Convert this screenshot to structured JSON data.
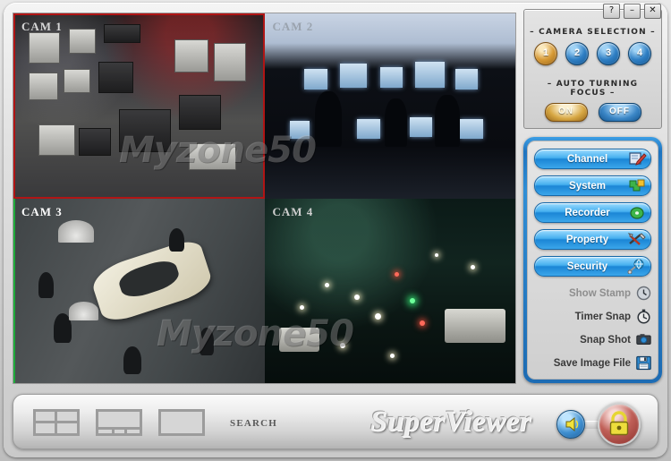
{
  "window": {
    "titlebar_buttons": [
      {
        "name": "help-button",
        "glyph": "?"
      },
      {
        "name": "minimize-button",
        "glyph": "–"
      },
      {
        "name": "close-button",
        "glyph": "✕"
      }
    ]
  },
  "video": {
    "cells": [
      {
        "label": "CAM 1",
        "scene": "security-equipment-shop",
        "active": true
      },
      {
        "label": "CAM 2",
        "scene": "control-room",
        "active": false
      },
      {
        "label": "CAM 3",
        "scene": "aerial-street-car",
        "active": false
      },
      {
        "label": "CAM 4",
        "scene": "night-traffic",
        "active": false
      }
    ],
    "watermark": "Myzone50"
  },
  "camera_selection": {
    "title": "–  CAMERA  SELECTION  –",
    "buttons": [
      {
        "label": "1",
        "selected": true
      },
      {
        "label": "2",
        "selected": false
      },
      {
        "label": "3",
        "selected": false
      },
      {
        "label": "4",
        "selected": false
      }
    ]
  },
  "auto_turning_focus": {
    "title": "–  AUTO  TURNING  FOCUS  –",
    "on_label": "ON",
    "off_label": "OFF",
    "selected": "ON"
  },
  "menu": {
    "items": [
      {
        "label": "Channel",
        "icon": "note-pencil-icon"
      },
      {
        "label": "System",
        "icon": "puzzle-icon"
      },
      {
        "label": "Recorder",
        "icon": "disc-icon"
      },
      {
        "label": "Property",
        "icon": "tools-icon"
      },
      {
        "label": "Security",
        "icon": "globe-plug-icon"
      }
    ]
  },
  "actions": {
    "items": [
      {
        "label": "Show Stamp",
        "icon": "clock-icon",
        "disabled": true
      },
      {
        "label": "Timer Snap",
        "icon": "stopwatch-icon",
        "disabled": false
      },
      {
        "label": "Snap Shot",
        "icon": "camera-icon",
        "disabled": false
      },
      {
        "label": "Save Image File",
        "icon": "floppy-disk-icon",
        "disabled": false
      }
    ]
  },
  "bottom_bar": {
    "layouts": [
      {
        "name": "layout-quad",
        "label": "2x2"
      },
      {
        "name": "layout-one-plus-three",
        "label": "1+3"
      },
      {
        "name": "layout-single",
        "label": "1"
      }
    ],
    "search_label": "SEARCH",
    "app_name": "SuperViewer",
    "sound_icon": "speaker-icon",
    "lock_icon": "lock-icon"
  },
  "colors": {
    "accent_blue": "#2f8ed6",
    "selected_gold": "#d79a36",
    "active_cell_border": "#b01515",
    "panel_gray": "#d7d7d7"
  }
}
